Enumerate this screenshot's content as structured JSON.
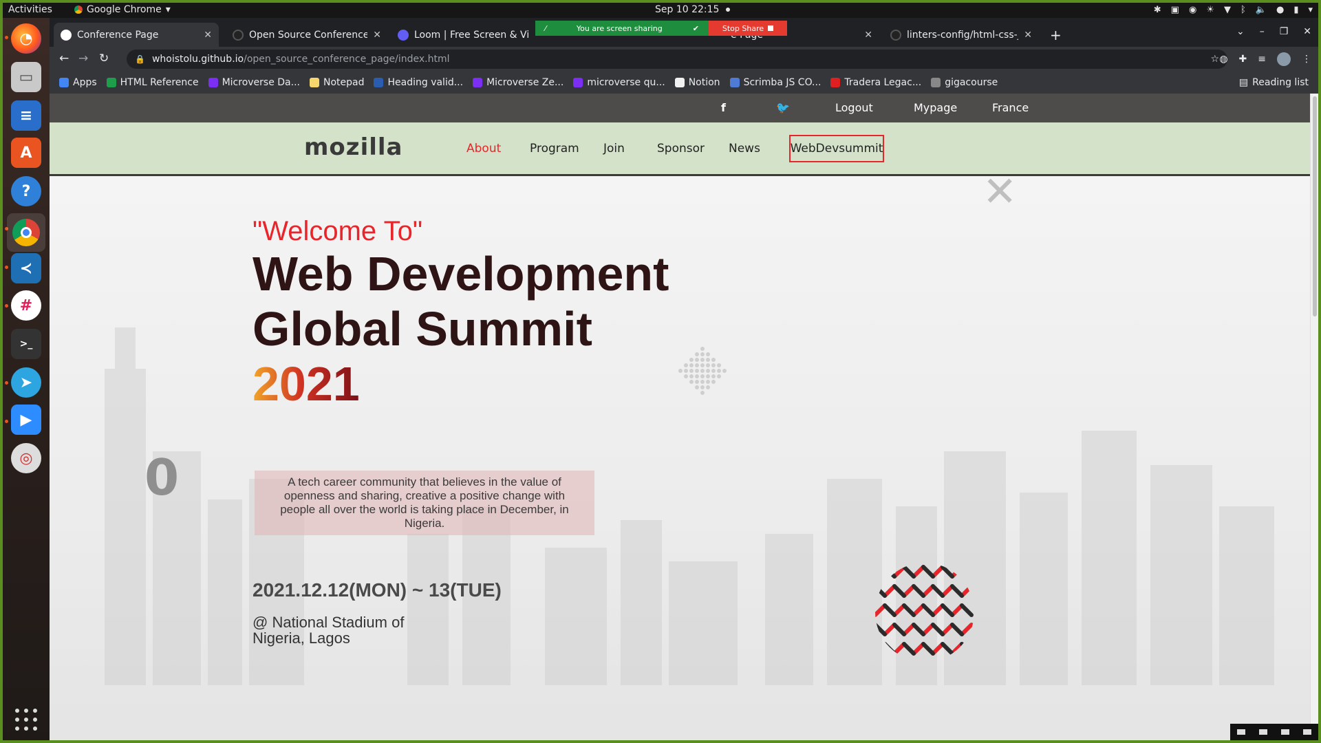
{
  "desktop": {
    "activities": "Activities",
    "app_name": "Google Chrome",
    "clock": "Sep 10  22:15"
  },
  "dock": {
    "items": [
      "firefox-icon",
      "files-icon",
      "writer-icon",
      "software-icon",
      "help-icon",
      "chrome-icon",
      "vscode-icon",
      "slack-icon",
      "terminal-icon",
      "telegram-icon",
      "zoom-icon",
      "lifebuoy-icon"
    ]
  },
  "browser": {
    "tabs": [
      {
        "title": "Conference Page",
        "active": true
      },
      {
        "title": "Open Source Conference",
        "active": false
      },
      {
        "title": "Loom | Free Screen & Vide",
        "active": false
      },
      {
        "title": "e Page",
        "active": false
      },
      {
        "title": "linters-config/html-css-js",
        "active": false
      }
    ],
    "share_message": "You are screen sharing",
    "stop_share": "Stop Share",
    "url_host": "whoistolu.github.io",
    "url_path": "/open_source_conference_page/index.html",
    "bookmarks": [
      "Apps",
      "HTML Reference",
      "Microverse Da...",
      "Notepad",
      "Heading valid...",
      "Microverse Ze...",
      "microverse qu...",
      "Notion",
      "Scrimba JS CO...",
      "Tradera Legac...",
      "gigacourse"
    ],
    "bookmark_colors": [
      "#4285f4",
      "#1e9e4a",
      "#7b2ff2",
      "#f5d76e",
      "#2a5db0",
      "#7b2ff2",
      "#7b2ff2",
      "#f1f1f1",
      "#4d7bd6",
      "#e02020",
      "#888888"
    ],
    "reading_list": "Reading list"
  },
  "page": {
    "topnav": {
      "logout": "Logout",
      "mypage": "Mypage",
      "language": "France"
    },
    "logo": "mozilla",
    "nav": [
      "About",
      "Program",
      "Join",
      "Sponsor",
      "News"
    ],
    "cta": "WebDevsummit",
    "welcome": "\"Welcome To\"",
    "headline_line1": "Web Development",
    "headline_line2": "Global Summit",
    "year": "2021",
    "description": "A tech career community that believes in the value of openness and sharing, creative a positive change with people all over the world is taking place in December, in Nigeria.",
    "date": "2021.12.12(MON) ~ 13(TUE)",
    "venue_line1": "@ National Stadium of",
    "venue_line2": "Nigeria, Lagos"
  },
  "colors": {
    "accent": "#e8252b",
    "nav_bg": "#d4e2c9",
    "topnav_bg": "#4e4b4b",
    "headline": "#2e1414"
  }
}
